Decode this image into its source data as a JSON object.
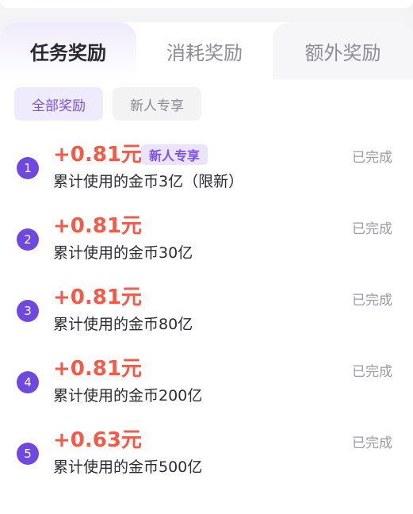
{
  "tabs": {
    "task": "任务奖励",
    "consume": "消耗奖励",
    "extra": "额外奖励"
  },
  "filters": {
    "all": "全部奖励",
    "new_user": "新人专享"
  },
  "rows": [
    {
      "index": "1",
      "amount": "+0.81元",
      "badge": "新人专享",
      "desc": "累计使用的金币3亿（限新）",
      "status": "已完成"
    },
    {
      "index": "2",
      "amount": "+0.81元",
      "desc": "累计使用的金币30亿",
      "status": "已完成"
    },
    {
      "index": "3",
      "amount": "+0.81元",
      "desc": "累计使用的金币80亿",
      "status": "已完成"
    },
    {
      "index": "4",
      "amount": "+0.81元",
      "desc": "累计使用的金币200亿",
      "status": "已完成"
    },
    {
      "index": "5",
      "amount": "+0.63元",
      "desc": "累计使用的金币500亿",
      "status": "已完成"
    }
  ],
  "colors": {
    "accent": "#6f48e0",
    "amount": "#f25a4a",
    "badge_bg": "#ece4fd"
  }
}
